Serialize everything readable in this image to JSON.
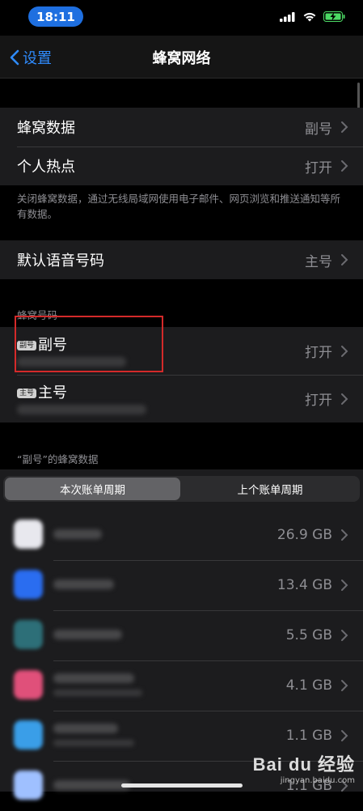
{
  "status_bar": {
    "time": "18:11"
  },
  "nav": {
    "back_label": "设置",
    "title": "蜂窝网络"
  },
  "group1": {
    "cellular_data": {
      "label": "蜂窝数据",
      "value": "副号"
    },
    "hotspot": {
      "label": "个人热点",
      "value": "打开"
    },
    "footnote": "关闭蜂窝数据，通过无线局域网使用电子邮件、网页浏览和推送通知等所有数据。"
  },
  "default_voice": {
    "label": "默认语音号码",
    "value": "主号"
  },
  "plans": {
    "section_header": "蜂窝号码",
    "items": [
      {
        "badge": "副号",
        "label": "副号",
        "value": "打开"
      },
      {
        "badge": "主号",
        "label": "主号",
        "value": "打开"
      }
    ]
  },
  "usage": {
    "section_header": "“副号”的蜂窝数据",
    "segments": [
      "本次账单周期",
      "上个账单周期"
    ],
    "active_segment": 0,
    "apps": [
      {
        "amount": "26.9 GB",
        "icon_color": "#e8e8ee"
      },
      {
        "amount": "13.4 GB",
        "icon_color": "#2a6df0"
      },
      {
        "amount": "5.5 GB",
        "icon_color": "#2d6f78"
      },
      {
        "amount": "4.1 GB",
        "icon_color": "#e0507a"
      },
      {
        "amount": "1.1 GB",
        "icon_color": "#3a9ee8"
      },
      {
        "amount": "1.1 GB",
        "icon_color": "#9fc0ff"
      }
    ]
  },
  "watermark": {
    "logo": "Bai du 经验",
    "site": "jingyan.baidu.com"
  }
}
